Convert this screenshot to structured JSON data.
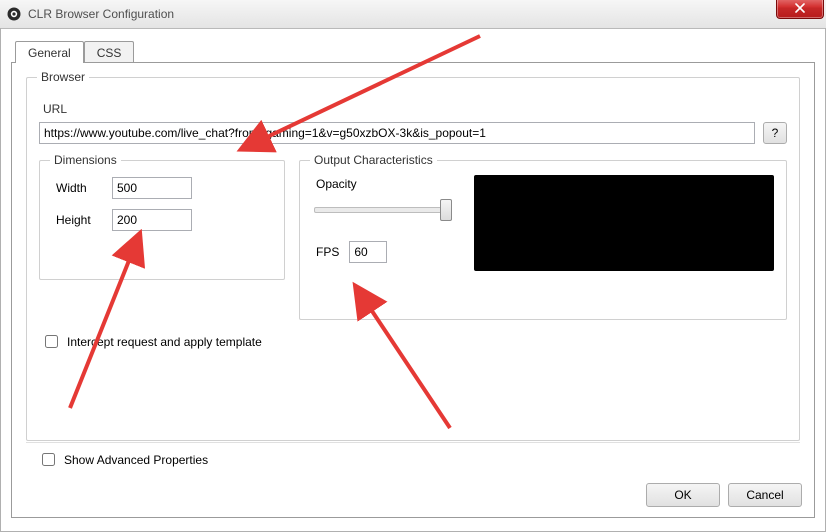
{
  "window": {
    "title": "CLR Browser Configuration"
  },
  "tabs": {
    "general": "General",
    "css": "CSS"
  },
  "browser": {
    "group_label": "Browser",
    "url_label": "URL",
    "url_value": "https://www.youtube.com/live_chat?from_gaming=1&v=g50xzbOX-3k&is_popout=1",
    "help_label": "?"
  },
  "dimensions": {
    "group_label": "Dimensions",
    "width_label": "Width",
    "width_value": "500",
    "height_label": "Height",
    "height_value": "200"
  },
  "output": {
    "group_label": "Output Characteristics",
    "opacity_label": "Opacity",
    "fps_label": "FPS",
    "fps_value": "60"
  },
  "intercept": {
    "label": "Intercept request and apply template"
  },
  "advanced": {
    "label": "Show Advanced Properties"
  },
  "footer": {
    "ok": "OK",
    "cancel": "Cancel"
  }
}
